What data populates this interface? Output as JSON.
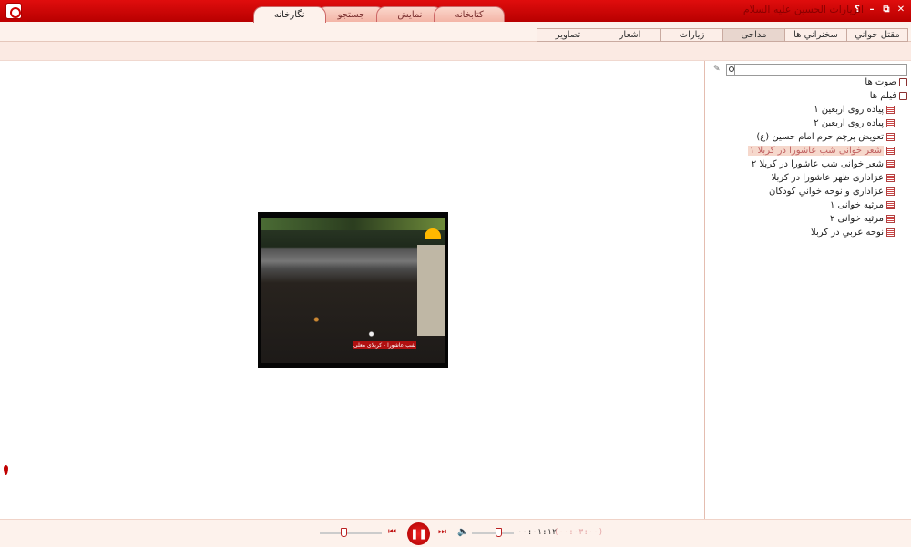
{
  "titlebar": {
    "app_title": "الزيارات الحسين عليه السلام",
    "help": "؟",
    "minimize": "–",
    "restore": "⧉",
    "close": "✕"
  },
  "top_tabs": [
    {
      "label": "نگارخانه"
    },
    {
      "label": "جستجو"
    },
    {
      "label": "نمایش"
    },
    {
      "label": "کتابخانه"
    }
  ],
  "sub_tabs": [
    {
      "label": "تصاویر"
    },
    {
      "label": "اشعار"
    },
    {
      "label": "زیارات"
    },
    {
      "label": "مداحی"
    },
    {
      "label": "سخنراني ها"
    },
    {
      "label": "مقتل خواني"
    }
  ],
  "video": {
    "caption": "شب عاشورا - کربلای معلی"
  },
  "tree": {
    "root_audio": "صوت ها",
    "root_video": "فیلم ها",
    "items": [
      {
        "label": "پیاده روی اربعین ۱"
      },
      {
        "label": "پیاده روی اربعین ۲"
      },
      {
        "label": "تعویض پرچم حرم امام حسین (ع)"
      },
      {
        "label": "شعر خوانی شب عاشورا در کربلا ۱"
      },
      {
        "label": "شعر خوانی شب عاشورا در کربلا ۲"
      },
      {
        "label": "عزاداری ظهر عاشورا در کربلا"
      },
      {
        "label": "عزاداری و نوحه خواني کودکان"
      },
      {
        "label": "مرثیه خوانی ۱"
      },
      {
        "label": "مرثیه خوانی ۲"
      },
      {
        "label": "نوحه عربي در کربلا"
      }
    ]
  },
  "player": {
    "current_time": "۰۰:۰۱:۱۲",
    "total_time": "(۰۰:۰۳:۰۰)",
    "play_pause": "❚❚",
    "prev": "⏮",
    "next": "⏭",
    "volume": "🔈"
  }
}
